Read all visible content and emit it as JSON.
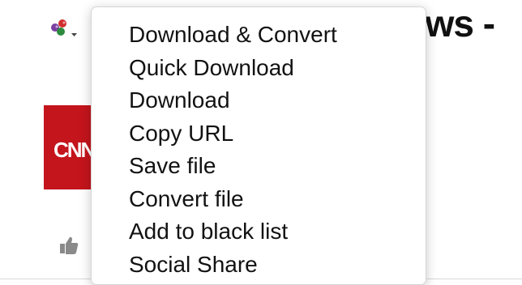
{
  "page": {
    "title_fragment": "ews -"
  },
  "extension": {
    "icon": "colored-balls-dropdown-icon",
    "colors": [
      "#7a3fa0",
      "#d22d2d",
      "#2d8a3e"
    ]
  },
  "background": {
    "logo_text": "CNN",
    "logo_color": "#c4141c"
  },
  "menu": {
    "items": [
      {
        "label": "Download & Convert"
      },
      {
        "label": "Quick Download"
      },
      {
        "label": "Download"
      },
      {
        "label": "Copy URL"
      },
      {
        "label": "Save file"
      },
      {
        "label": "Convert file"
      },
      {
        "label": "Add to black list"
      },
      {
        "label": "Social Share"
      }
    ]
  }
}
